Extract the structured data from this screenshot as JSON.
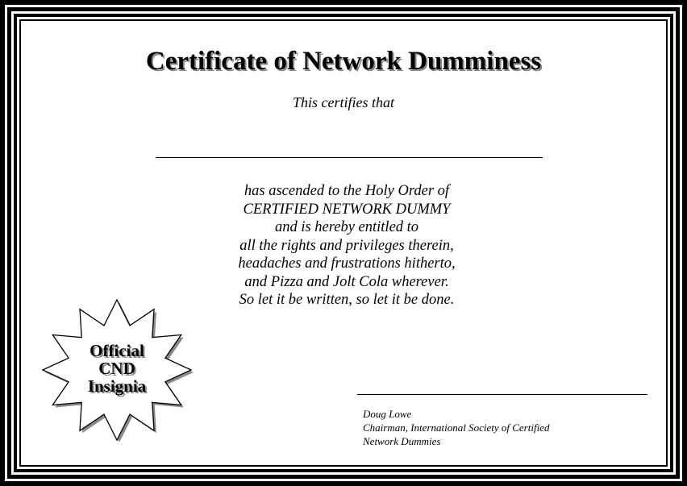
{
  "certificate": {
    "title": "Certificate of Network Dumminess",
    "subtitle": "This certifies that",
    "body_lines": [
      "has ascended to the Holy Order of",
      "CERTIFIED NETWORK DUMMY",
      "and is hereby entitled to",
      "all the rights and privileges therein,",
      "headaches and frustrations hitherto,",
      "and Pizza and Jolt Cola wherever.",
      "So let it be written, so let it be done."
    ]
  },
  "seal": {
    "lines": [
      "Official",
      "CND",
      "Insignia"
    ]
  },
  "signature": {
    "name": "Doug Lowe",
    "title_line1": "Chairman, International Society of Certified",
    "title_line2": "Network Dummies"
  }
}
